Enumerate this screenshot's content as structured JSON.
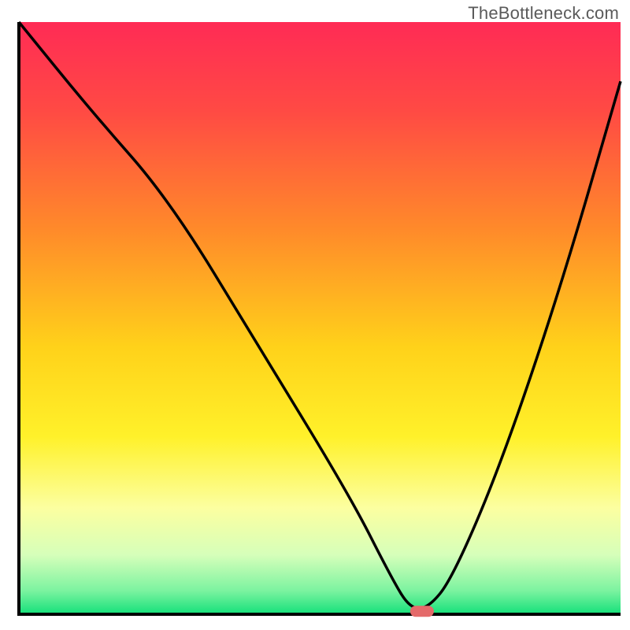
{
  "watermark": "TheBottleneck.com",
  "chart_data": {
    "type": "line",
    "title": "",
    "xlabel": "",
    "ylabel": "",
    "xlim": [
      0,
      100
    ],
    "ylim": [
      0,
      100
    ],
    "gradient_stops": [
      {
        "offset": 0,
        "color": "#ff2b55"
      },
      {
        "offset": 15,
        "color": "#ff4a44"
      },
      {
        "offset": 35,
        "color": "#ff8a2a"
      },
      {
        "offset": 55,
        "color": "#ffd21a"
      },
      {
        "offset": 70,
        "color": "#fff12a"
      },
      {
        "offset": 82,
        "color": "#fcffa0"
      },
      {
        "offset": 90,
        "color": "#d6ffba"
      },
      {
        "offset": 96,
        "color": "#7cf3a0"
      },
      {
        "offset": 100,
        "color": "#14e07a"
      }
    ],
    "series": [
      {
        "name": "bottleneck-curve",
        "x": [
          0,
          12,
          25,
          40,
          55,
          62,
          65,
          68,
          72,
          80,
          90,
          100
        ],
        "y": [
          100,
          85,
          70,
          45,
          20,
          6,
          1,
          1,
          6,
          25,
          55,
          90
        ]
      }
    ],
    "marker": {
      "x": 67,
      "y": 0.5,
      "color": "#e46a6a"
    },
    "colors": {
      "axis": "#000000",
      "curve": "#000000",
      "marker": "#e46a6a"
    }
  }
}
